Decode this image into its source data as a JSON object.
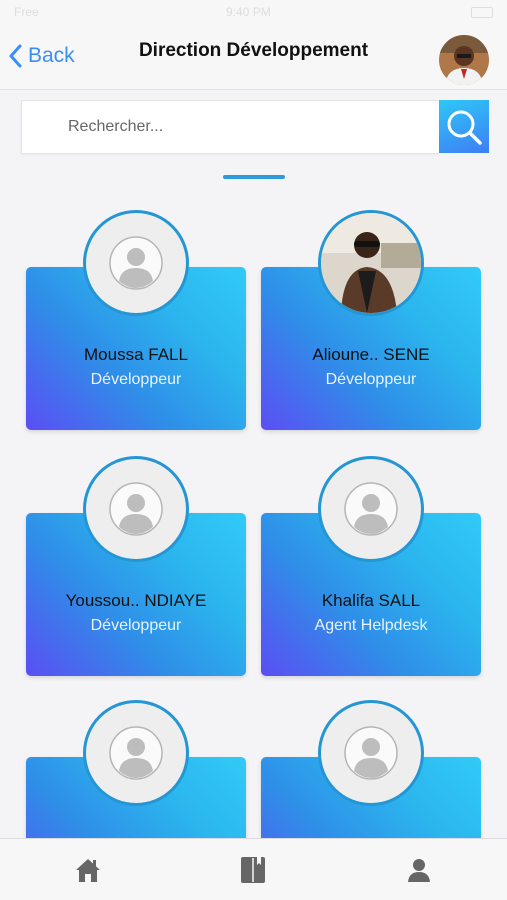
{
  "status_bar": {
    "carrier": "Free",
    "time": "9:40 PM"
  },
  "nav": {
    "back_label": "Back",
    "title": "Direction Développement"
  },
  "search": {
    "placeholder": "Rechercher..."
  },
  "colors": {
    "accent": "#3a8ef6",
    "card_gradient_start": "#5b4ef4",
    "card_gradient_end": "#31caf8",
    "indicator": "#2d9bdb"
  },
  "employees": [
    {
      "name": "Moussa FALL",
      "role": "Développeur",
      "avatar": "default-avatar-icon"
    },
    {
      "name": "Alioune.. SENE",
      "role": "Développeur",
      "avatar": "photo"
    },
    {
      "name": "Youssou.. NDIAYE",
      "role": "Développeur",
      "avatar": "default-avatar-icon"
    },
    {
      "name": "Khalifa SALL",
      "role": "Agent Helpdesk",
      "avatar": "default-avatar-icon"
    },
    {
      "name": "",
      "role": "",
      "avatar": "default-avatar-icon"
    },
    {
      "name": "",
      "role": "",
      "avatar": "default-avatar-icon"
    }
  ],
  "tab_bar": {
    "items": [
      "home-icon",
      "book-icon",
      "profile-icon"
    ]
  }
}
